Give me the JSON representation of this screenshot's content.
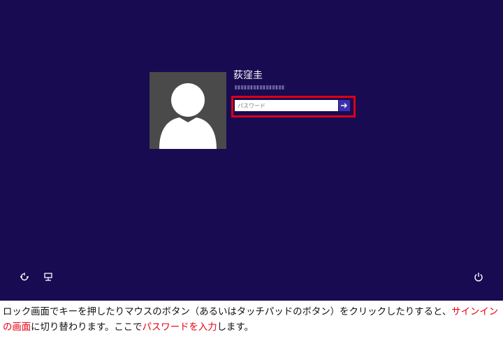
{
  "user": {
    "name": "荻窪圭"
  },
  "password": {
    "placeholder": "パスワード",
    "value": ""
  },
  "icons": {
    "submit": "arrow-right-icon",
    "ease_of_access": "ease-of-access-icon",
    "network": "network-icon",
    "power": "power-icon"
  },
  "colors": {
    "background": "#180b52",
    "avatar_bg": "#4a4a4a",
    "submit_button": "#3c2fb0",
    "highlight_border": "#e00012",
    "caption_emphasis": "#e60012"
  },
  "caption": {
    "part1": "ロック画面でキーを押したりマウスのボタン（あるいはタッチパッドのボタン）をクリックしたりすると、",
    "part2": "サインインの画面",
    "part3": "に切り替わります。ここで",
    "part4": "パスワードを入力",
    "part5": "します。"
  }
}
